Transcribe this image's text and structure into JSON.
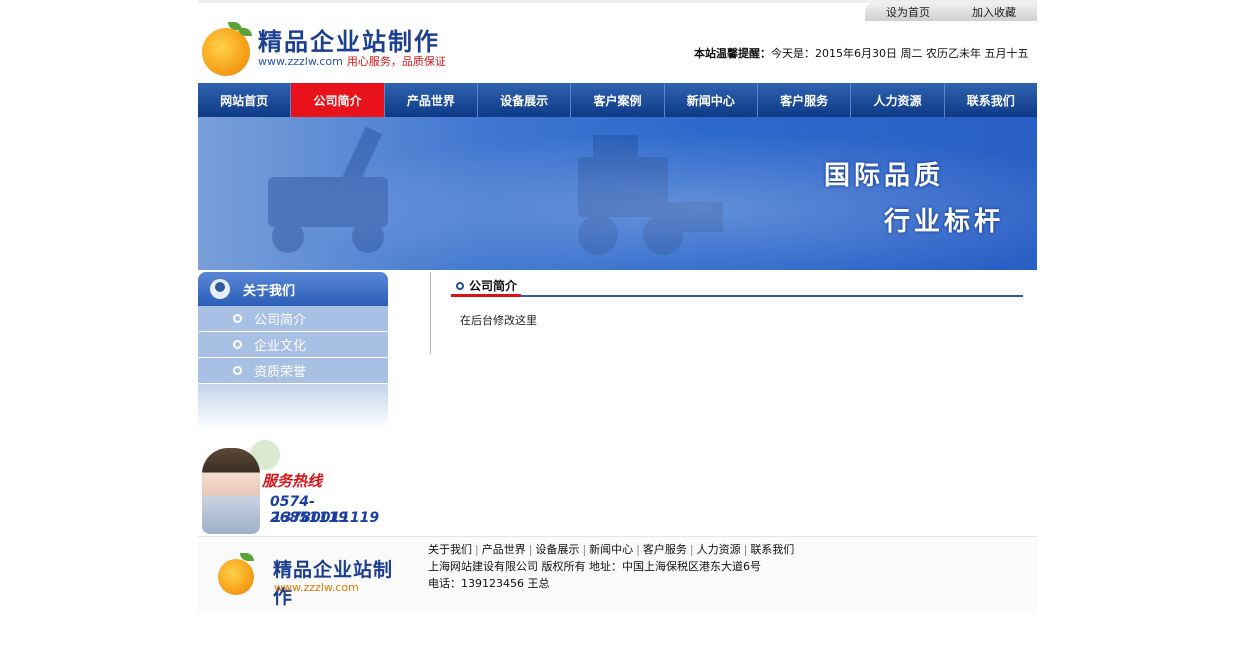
{
  "toplinks": {
    "set_home": "设为首页",
    "bookmark": "加入收藏"
  },
  "logo": {
    "title": "精品企业站制作",
    "url": "www.zzzlw.com",
    "slogan": "用心服务，品质保证"
  },
  "date": {
    "label": "本站温馨提醒：",
    "text": "今天是：2015年6月30日 周二 农历乙未年 五月十五"
  },
  "nav": [
    "网站首页",
    "公司简介",
    "产品世界",
    "设备展示",
    "客户案例",
    "新闻中心",
    "客户服务",
    "人力资源",
    "联系我们"
  ],
  "banner": {
    "line1": "国际品质",
    "line2": "行业标杆"
  },
  "sidebar": {
    "title": "关于我们",
    "items": [
      "公司简介",
      "企业文化",
      "资质荣誉"
    ]
  },
  "hotline": {
    "title": "服务热线",
    "phone1": "0574-26851119",
    "phone2": "13780011119"
  },
  "content": {
    "title": "公司简介",
    "body": "在后台修改这里"
  },
  "footer": {
    "logo_title": "精品企业站制作",
    "logo_url": "www.zzzlw.com",
    "links": [
      "关于我们",
      "产品世界",
      "设备展示",
      "新闻中心",
      "客户服务",
      "人力资源",
      "联系我们"
    ],
    "company": "上海网站建设有限公司 版权所有 地址：中国上海保税区港东大道6号",
    "phone_label": "电话：",
    "phone": "139123456 王总"
  }
}
